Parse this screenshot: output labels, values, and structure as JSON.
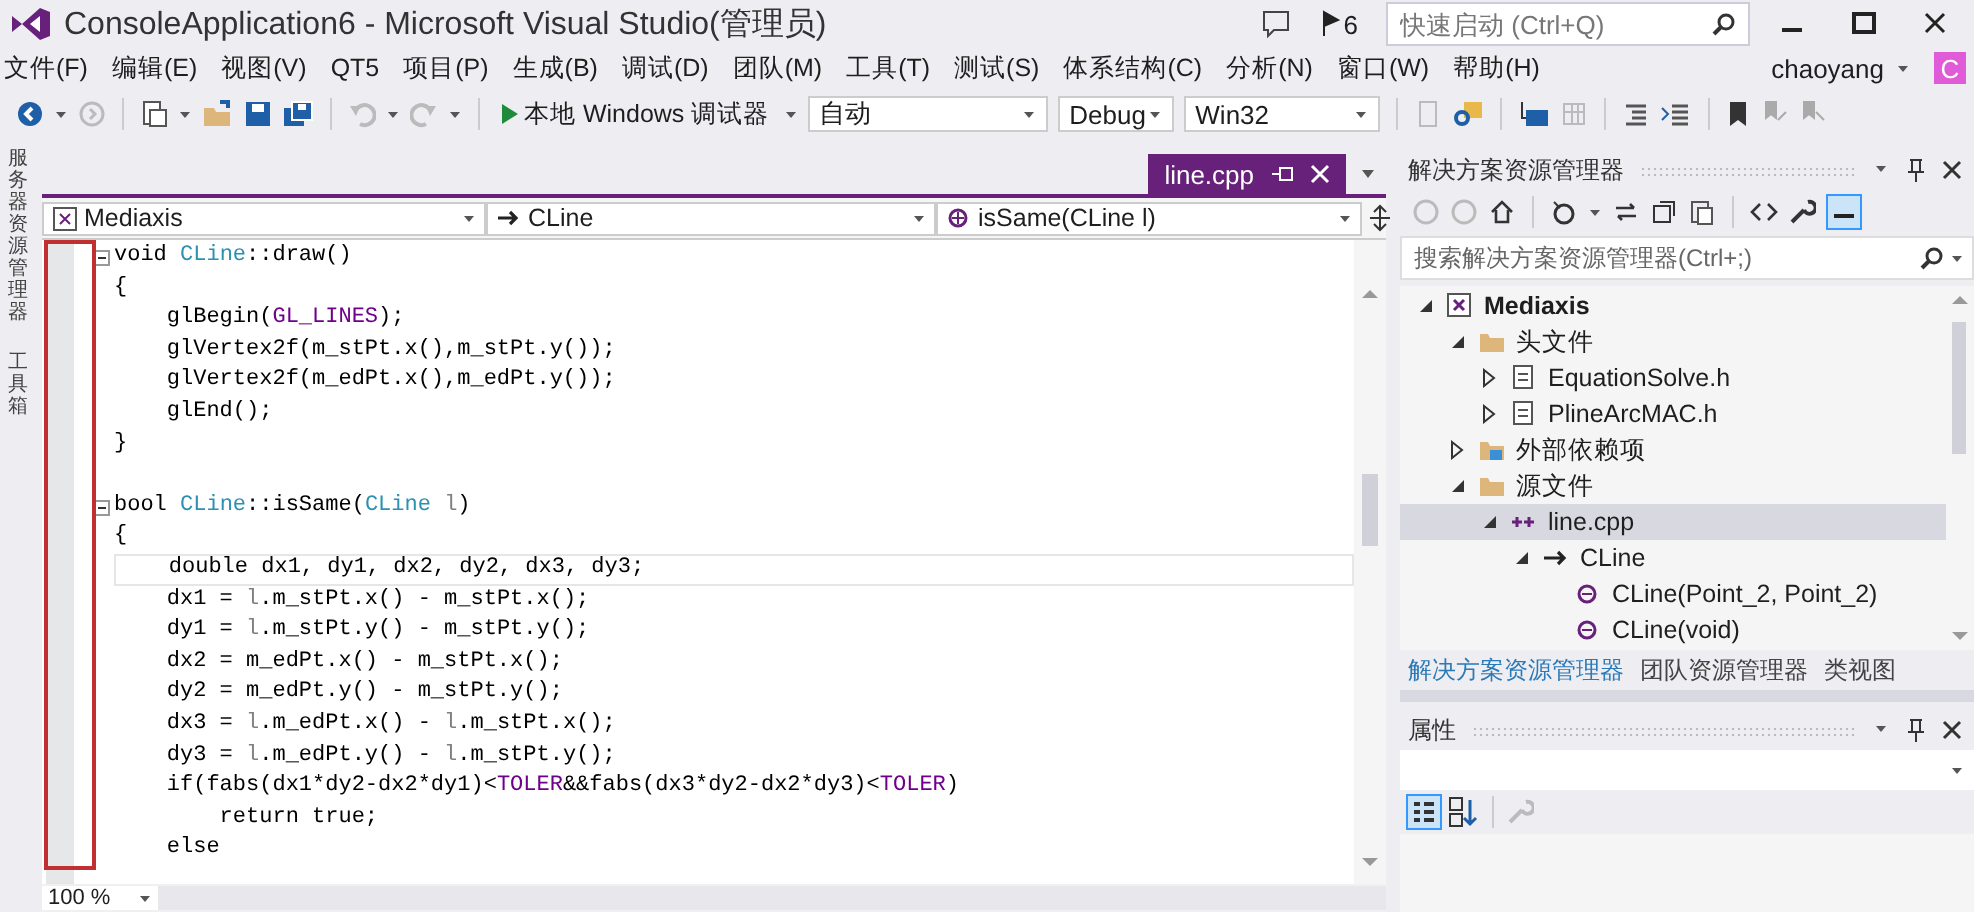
{
  "window": {
    "title": "ConsoleApplication6 - Microsoft Visual Studio(管理员)",
    "notification_count": "6",
    "quick_launch": {
      "placeholder": "快速启动 (Ctrl+Q)"
    },
    "user": "chaoyang",
    "avatar_letter": "C"
  },
  "menu": [
    "文件(F)",
    "编辑(E)",
    "视图(V)",
    "QT5",
    "项目(P)",
    "生成(B)",
    "调试(D)",
    "团队(M)",
    "工具(T)",
    "测试(S)",
    "体系结构(C)",
    "分析(N)",
    "窗口(W)",
    "帮助(H)"
  ],
  "toolbar": {
    "debugger": "本地 Windows 调试器",
    "solution_config": "自动",
    "configuration": "Debug",
    "platform": "Win32"
  },
  "side_tabs": [
    "服务器资源管理器",
    "工具箱"
  ],
  "editor": {
    "tabs": [
      {
        "label": "line.cpp",
        "selected": true
      }
    ],
    "nav": [
      "Mediaxis",
      "CLine",
      "isSame(CLine l)"
    ],
    "zoom": "100 %",
    "lines": [
      {
        "fold": true,
        "segments": [
          {
            "text": "void ",
            "kind": "plain"
          },
          {
            "text": "CLine",
            "kind": "type"
          },
          {
            "text": "::draw()",
            "kind": "plain"
          }
        ]
      },
      {
        "segments": [
          {
            "text": "{",
            "kind": "plain"
          }
        ]
      },
      {
        "segments": [
          {
            "text": "    glBegin(",
            "kind": "plain"
          },
          {
            "text": "GL_LINES",
            "kind": "macro"
          },
          {
            "text": ");",
            "kind": "plain"
          }
        ]
      },
      {
        "segments": [
          {
            "text": "    glVertex2f(m_stPt.x(),m_stPt.y());",
            "kind": "plain"
          }
        ]
      },
      {
        "segments": [
          {
            "text": "    glVertex2f(m_edPt.x(),m_edPt.y());",
            "kind": "plain"
          }
        ]
      },
      {
        "segments": [
          {
            "text": "    glEnd();",
            "kind": "plain"
          }
        ]
      },
      {
        "segments": [
          {
            "text": "}",
            "kind": "plain"
          }
        ]
      },
      {
        "fold": true,
        "space_before": true,
        "segments": [
          {
            "text": "bool ",
            "kind": "plain"
          },
          {
            "text": "CLine",
            "kind": "type"
          },
          {
            "text": "::isSame(",
            "kind": "plain"
          },
          {
            "text": "CLine",
            "kind": "type"
          },
          {
            "text": " l",
            "kind": "param"
          },
          {
            "text": ")",
            "kind": "plain"
          }
        ]
      },
      {
        "segments": [
          {
            "text": "{",
            "kind": "plain"
          }
        ]
      },
      {
        "current": true,
        "segments": [
          {
            "text": "    double dx1, dy1, dx2, dy2, dx3, dy3;",
            "kind": "plain"
          }
        ]
      },
      {
        "segments": [
          {
            "text": "    dx1 = ",
            "kind": "plain"
          },
          {
            "text": "l",
            "kind": "param"
          },
          {
            "text": ".m_stPt.x() - m_stPt.x();",
            "kind": "plain"
          }
        ]
      },
      {
        "segments": [
          {
            "text": "    dy1 = ",
            "kind": "plain"
          },
          {
            "text": "l",
            "kind": "param"
          },
          {
            "text": ".m_stPt.y() - m_stPt.y();",
            "kind": "plain"
          }
        ]
      },
      {
        "segments": [
          {
            "text": "    dx2 = m_edPt.x() - m_stPt.x();",
            "kind": "plain"
          }
        ]
      },
      {
        "segments": [
          {
            "text": "    dy2 = m_edPt.y() - m_stPt.y();",
            "kind": "plain"
          }
        ]
      },
      {
        "segments": [
          {
            "text": "    dx3 = ",
            "kind": "plain"
          },
          {
            "text": "l",
            "kind": "param"
          },
          {
            "text": ".m_edPt.x() - ",
            "kind": "plain"
          },
          {
            "text": "l",
            "kind": "param"
          },
          {
            "text": ".m_stPt.x();",
            "kind": "plain"
          }
        ]
      },
      {
        "segments": [
          {
            "text": "    dy3 = ",
            "kind": "plain"
          },
          {
            "text": "l",
            "kind": "param"
          },
          {
            "text": ".m_edPt.y() - ",
            "kind": "plain"
          },
          {
            "text": "l",
            "kind": "param"
          },
          {
            "text": ".m_stPt.y();",
            "kind": "plain"
          }
        ]
      },
      {
        "segments": [
          {
            "text": "    if(fabs(dx1*dy2-dx2*dy1)<",
            "kind": "plain"
          },
          {
            "text": "TOLER",
            "kind": "macro"
          },
          {
            "text": "&&fabs(dx3*dy2-dx2*dy3)<",
            "kind": "plain"
          },
          {
            "text": "TOLER",
            "kind": "macro"
          },
          {
            "text": ")",
            "kind": "plain"
          }
        ]
      },
      {
        "segments": [
          {
            "text": "        return true;",
            "kind": "plain"
          }
        ]
      },
      {
        "segments": [
          {
            "text": "    else",
            "kind": "plain"
          }
        ]
      }
    ]
  },
  "solution_explorer": {
    "title": "解决方案资源管理器",
    "search": {
      "placeholder": "搜索解决方案资源管理器(Ctrl+;)"
    },
    "tree": [
      {
        "label": "Mediaxis",
        "kind": "project",
        "expanded": true,
        "selected": false,
        "children": [
          {
            "label": "头文件",
            "kind": "folder",
            "expanded": true,
            "selected": false,
            "children": [
              {
                "label": "EquationSolve.h",
                "kind": "header",
                "expanded": false,
                "selected": false
              },
              {
                "label": "PlineArcMAC.h",
                "kind": "header",
                "expanded": false,
                "selected": false
              }
            ]
          },
          {
            "label": "外部依赖项",
            "kind": "external",
            "expanded": false,
            "selected": false
          },
          {
            "label": "源文件",
            "kind": "folder",
            "expanded": true,
            "selected": false,
            "children": [
              {
                "label": "line.cpp",
                "kind": "cpp",
                "expanded": true,
                "selected": true,
                "children": [
                  {
                    "label": "CLine",
                    "kind": "class",
                    "expanded": true,
                    "selected": false,
                    "children": [
                      {
                        "label": "CLine(Point_2, Point_2)",
                        "kind": "method",
                        "selected": false
                      },
                      {
                        "label": "CLine(void)",
                        "kind": "method",
                        "selected": false
                      }
                    ]
                  }
                ]
              }
            ]
          }
        ]
      }
    ],
    "tabs": [
      {
        "label": "解决方案资源管理器",
        "selected": true
      },
      {
        "label": "团队资源管理器",
        "selected": false
      },
      {
        "label": "类视图",
        "selected": false
      }
    ]
  },
  "properties": {
    "title": "属性"
  }
}
